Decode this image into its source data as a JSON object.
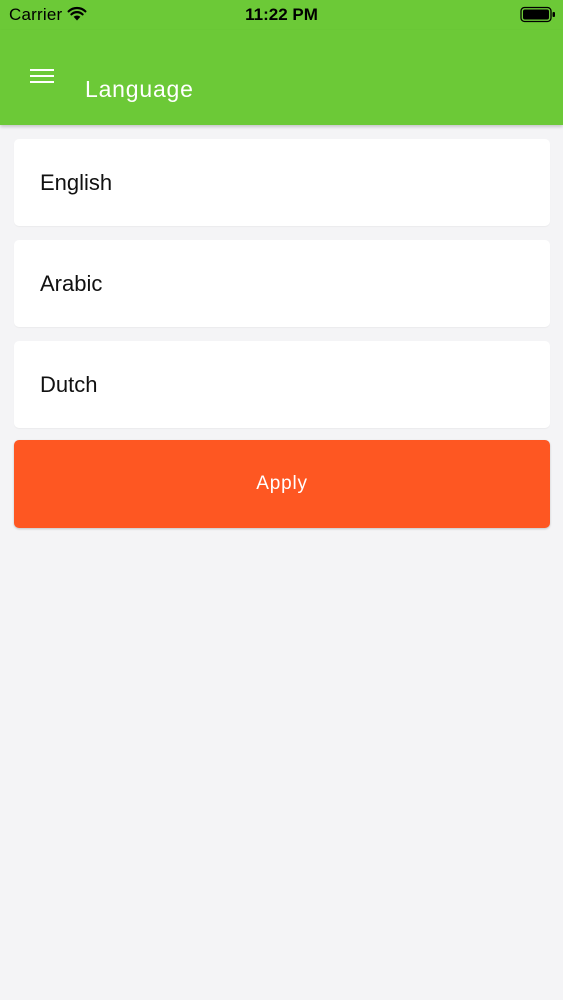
{
  "status_bar": {
    "carrier": "Carrier",
    "time": "11:22 PM",
    "icons": [
      "wifi-icon",
      "battery-icon"
    ]
  },
  "header": {
    "title": "Language",
    "menu_icon": "menu-icon"
  },
  "languages": [
    {
      "label": "English"
    },
    {
      "label": "Arabic"
    },
    {
      "label": "Dutch"
    }
  ],
  "apply_button": {
    "label": "Apply"
  },
  "colors": {
    "header_background": "#6cc937",
    "apply_button": "#fe5722",
    "page_background": "#f4f4f6",
    "card_background": "#ffffff"
  }
}
